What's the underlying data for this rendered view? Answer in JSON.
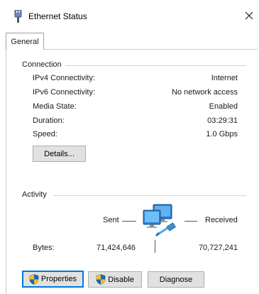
{
  "window": {
    "title": "Ethernet Status"
  },
  "tabs": [
    {
      "label": "General"
    }
  ],
  "connection": {
    "group_label": "Connection",
    "rows": [
      {
        "label": "IPv4 Connectivity:",
        "value": "Internet"
      },
      {
        "label": "IPv6 Connectivity:",
        "value": "No network access"
      },
      {
        "label": "Media State:",
        "value": "Enabled"
      },
      {
        "label": "Duration:",
        "value": "03:29:31"
      },
      {
        "label": "Speed:",
        "value": "1.0 Gbps"
      }
    ],
    "details_label": "Details..."
  },
  "activity": {
    "group_label": "Activity",
    "sent_label": "Sent",
    "received_label": "Received",
    "bytes_label": "Bytes:",
    "bytes_sent": "71,424,646",
    "bytes_received": "70,727,241"
  },
  "buttons": {
    "properties_label": "Properties",
    "disable_label": "Disable",
    "diagnose_label": "Diagnose"
  },
  "icons": {
    "title": "ethernet-plug-icon",
    "close": "close-icon",
    "network": "network-computers-icon",
    "uac": "uac-shield-icon"
  },
  "colors": {
    "focus_border": "#0078d7",
    "button_face": "#e1e1e1",
    "shield_blue": "#1e64c8",
    "shield_yellow": "#f2c318"
  }
}
